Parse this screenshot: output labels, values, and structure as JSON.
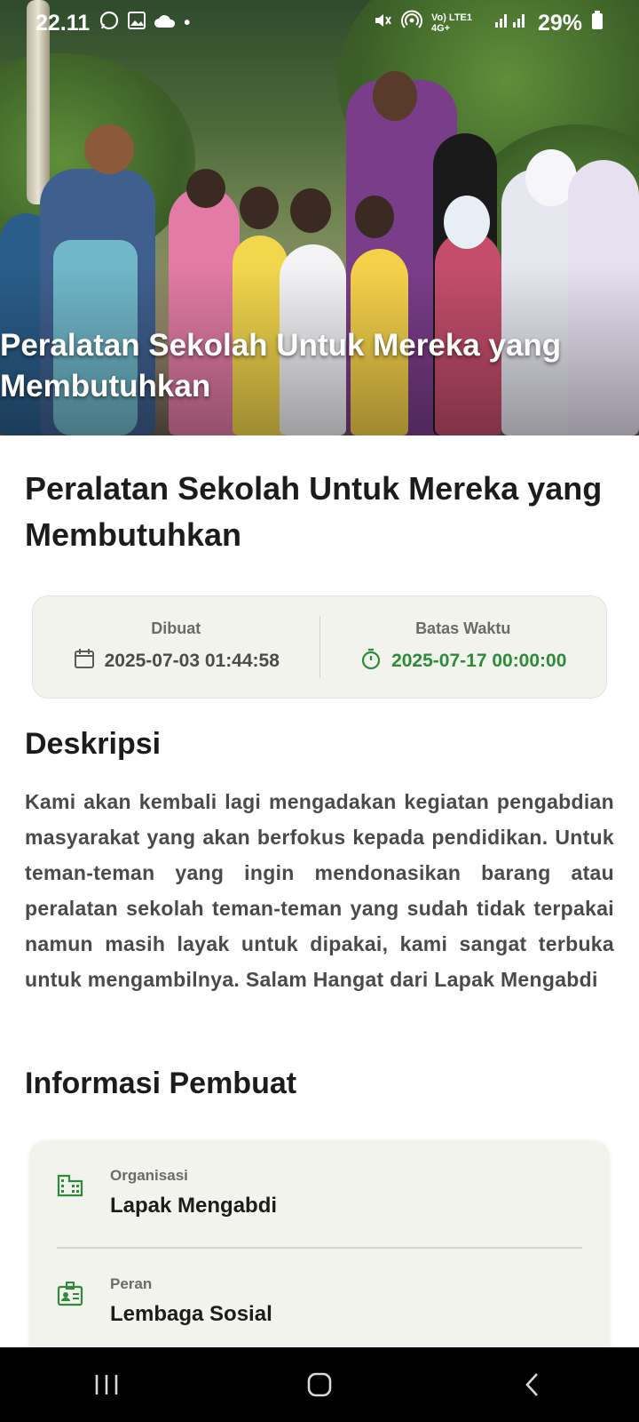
{
  "status_bar": {
    "time": "22.11",
    "network": "Vo) LTE1 4G+",
    "battery": "29%"
  },
  "hero": {
    "overlay_title": "Peralatan Sekolah Untuk Mereka yang Membutuhkan"
  },
  "detail": {
    "title": "Peralatan Sekolah Untuk Mereka yang Membutuhkan",
    "created_label": "Dibuat",
    "created_value": "2025-07-03 01:44:58",
    "deadline_label": "Batas Waktu",
    "deadline_value": "2025-07-17 00:00:00",
    "description_heading": "Deskripsi",
    "description": "Kami akan kembali lagi mengadakan kegiatan pengabdian masyarakat yang akan berfokus kepada pendidikan. Untuk teman-teman yang ingin mendonasikan barang atau peralatan sekolah teman-teman yang sudah tidak terpakai namun masih layak untuk dipakai, kami sangat terbuka untuk mengambilnya. Salam Hangat dari Lapak Mengabdi",
    "creator_heading": "Informasi Pembuat",
    "organization_label": "Organisasi",
    "organization_value": "Lapak Mengabdi",
    "role_label": "Peran",
    "role_value": "Lembaga Sosial"
  },
  "colors": {
    "accent_green": "#2e8b3a",
    "card_bg": "#f1f3ec"
  },
  "icons": {
    "calendar": "calendar-icon",
    "timer": "timer-icon",
    "organization": "building-icon",
    "role": "badge-icon",
    "nav_recent": "recent-apps-icon",
    "nav_home": "home-icon",
    "nav_back": "back-icon"
  }
}
